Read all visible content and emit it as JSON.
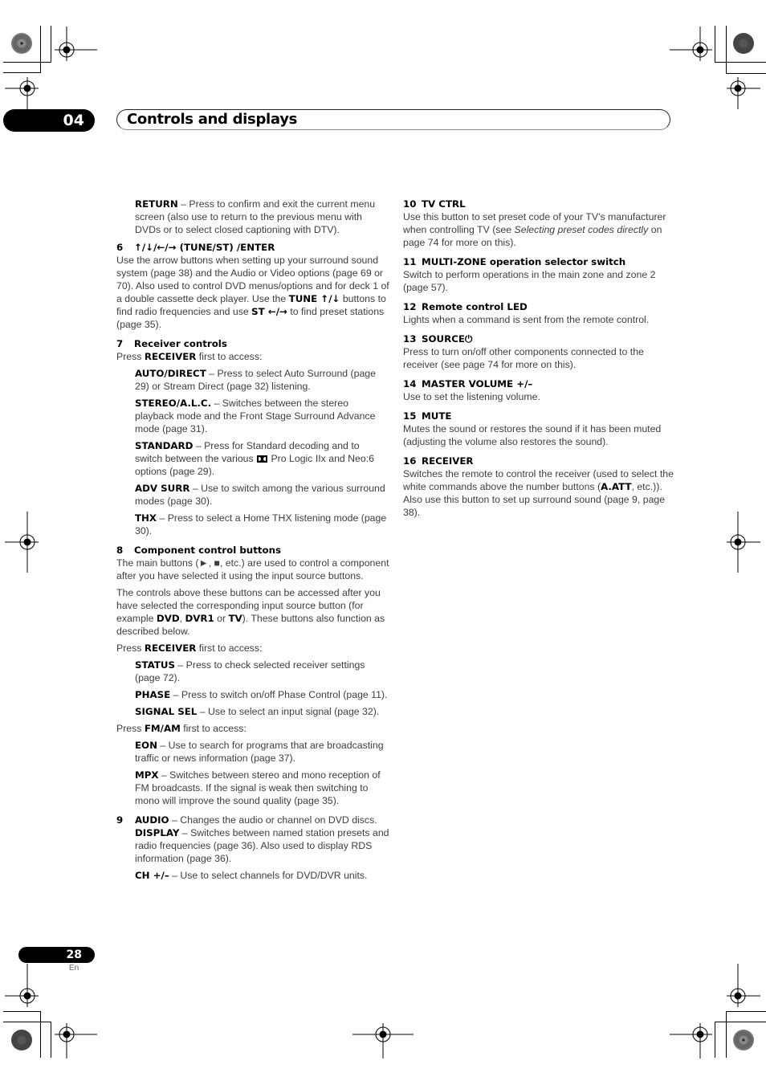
{
  "header": {
    "chapter_number": "04",
    "chapter_title": "Controls and displays"
  },
  "left_column": {
    "return_label": "RETURN",
    "return_text": " – Press to confirm and exit the current menu screen (also use to return to the previous menu with DVDs or to select closed captioning with DTV).",
    "s6": {
      "number": "6",
      "title": "↑/↓/←/→ (TUNE/ST) /ENTER",
      "body_1": "Use the arrow buttons when setting up your surround sound system (page 38) and the Audio or Video options (page 69 or 70). Also used to control DVD menus/options and for deck 1 of a double cassette deck player. Use the ",
      "tune": "TUNE ↑/↓",
      "body_2": " buttons to find radio frequencies and use ",
      "st": "ST ←/→",
      "body_3": " to find preset stations (page 35)."
    },
    "s7": {
      "number": "7",
      "title": "Receiver controls",
      "press_pre": "Press ",
      "press_key": "RECEIVER",
      "press_post": " first to access:",
      "items": [
        {
          "label": "AUTO/DIRECT",
          "text": " – Press to select Auto Surround (page 29) or Stream Direct (page 32) listening."
        },
        {
          "label": "STEREO/A.L.C.",
          "text": " – Switches between the stereo playback mode and the Front Stage Surround Advance mode (page 31)."
        },
        {
          "label": "STANDARD",
          "text_1": " – Press for Standard decoding and to switch between the various ",
          "dolby": "DD",
          "text_2": " Pro Logic IIx and Neo:6 options (page 29)."
        },
        {
          "label": "ADV SURR",
          "text": " – Use to switch among the various surround modes (page 30)."
        },
        {
          "label": "THX",
          "text": " – Press to select a Home THX listening mode (page 30)."
        }
      ]
    },
    "s8": {
      "number": "8",
      "title": "Component control buttons",
      "para_1": "The main buttons (►, ■, etc.) are used to control a component after you have selected it using the input source buttons.",
      "para_2_a": "The controls above these buttons can be accessed after you have selected the corresponding input source button (for example ",
      "dvd": "DVD",
      "comma": ", ",
      "dvr1": "DVR1",
      "or": " or ",
      "tv": "TV",
      "para_2_b": "). These buttons also function as described below.",
      "press_receiver_pre": "Press ",
      "press_receiver_key": "RECEIVER",
      "press_receiver_post": " first to access:",
      "receiver_items": [
        {
          "label": "STATUS",
          "text": " – Press to check selected receiver settings (page 72)."
        },
        {
          "label": "PHASE",
          "text": " – Press to switch on/off Phase Control (page 11)."
        },
        {
          "label": "SIGNAL SEL",
          "text": " – Use to select an input signal (page 32)."
        }
      ],
      "press_fmam_pre": "Press ",
      "press_fmam_key": "FM/AM",
      "press_fmam_post": " first to access:",
      "fmam_items": [
        {
          "label": "EON",
          "text": " – Use to search for programs that are broadcasting traffic or news information (page 37)."
        },
        {
          "label": "MPX",
          "text": " – Switches between stereo and mono reception of FM broadcasts. If the signal is weak then switching to mono will improve the sound quality (page 35)."
        }
      ]
    },
    "s9": {
      "number": "9",
      "audio_label": "AUDIO",
      "audio_text": " – Changes the audio or channel on DVD discs.",
      "display_label": "DISPLAY",
      "display_text": " – Switches between named station presets and radio frequencies (page 36). Also used to display RDS information (page 36).",
      "ch_label": "CH +/–",
      "ch_text": " – Use to select channels for DVD/DVR units."
    }
  },
  "right_column": {
    "sections": [
      {
        "number": "10",
        "title": "TV CTRL",
        "body_1": "Use this button to set preset code of your TV's manufacturer when controlling TV (see ",
        "italic": "Selecting preset codes directly",
        "body_2": " on page 74 for more on this)."
      },
      {
        "number": "11",
        "title": "MULTI-ZONE operation selector switch",
        "body": "Switch to perform operations in the main zone and zone 2 (page 57)."
      },
      {
        "number": "12",
        "title": "Remote control LED",
        "body": "Lights when a command is sent from the remote control."
      },
      {
        "number": "13",
        "title": "SOURCE⏻",
        "body": "Press to turn on/off other components connected to the receiver (see page 74 for more on this)."
      },
      {
        "number": "14",
        "title": "MASTER VOLUME +/–",
        "body": "Use to set the listening volume."
      },
      {
        "number": "15",
        "title": "MUTE",
        "body": "Mutes the sound or restores the sound if it has been muted (adjusting the volume also restores the sound)."
      },
      {
        "number": "16",
        "title": "RECEIVER",
        "body_1": "Switches the remote to control the receiver (used to select the white commands above the number buttons (",
        "bold": "A.ATT",
        "body_2": ", etc.)). Also use this button to set up surround sound (page 9, page 38)."
      }
    ]
  },
  "footer": {
    "page_number": "28",
    "language": "En"
  }
}
